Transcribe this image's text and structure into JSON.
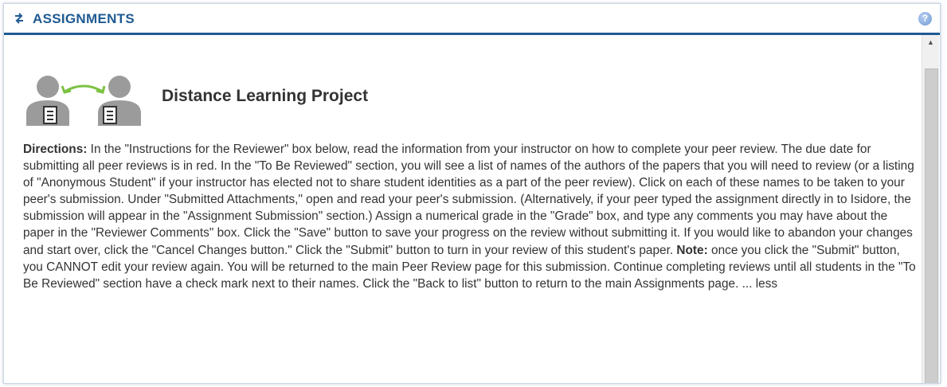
{
  "header": {
    "title": "ASSIGNMENTS",
    "swap_icon": "swap-arrows-icon",
    "help_icon": "help-icon",
    "help_glyph": "?"
  },
  "project": {
    "title": "Distance Learning Project",
    "icon": "peer-review-icon"
  },
  "directions": {
    "label": "Directions:",
    "text1": " In the \"Instructions for the Reviewer\" box below, read the information from your instructor on how to complete your peer review. The due date for submitting all peer reviews is in red. In the \"To Be Reviewed\" section, you will see a list of names of the authors of the papers that you will need to review (or a listing of \"Anonymous Student\" if your instructor has elected not to share student identities as a part of the peer review). Click on each of these names to be taken to your peer's submission. Under \"Submitted Attachments,\" open and read your peer's submission. (Alternatively, if your peer typed the assignment directly in to Isidore, the submission will appear in the \"Assignment Submission\" section.) Assign a numerical grade in the \"Grade\" box, and type any comments you may have about the paper in the \"Reviewer Comments\" box. Click the \"Save\" button to save your progress on the review without submitting it. If you would like to abandon your changes and start over, click the \"Cancel Changes button.\" Click the \"Submit\" button to turn in your review of this student's paper. ",
    "note_label": "Note:",
    "text2": " once you click the \"Submit\" button, you CANNOT edit your review again. You will be returned to the main Peer Review page for this submission. Continue completing reviews until all students in the \"To Be Reviewed\" section have a check mark next to their names. Click the \"Back to list\" button to return to the main Assignments page. ",
    "less_link": "... less"
  },
  "colors": {
    "accent": "#1f5a93",
    "arrow": "#7cc242",
    "person": "#9b9b9b"
  }
}
